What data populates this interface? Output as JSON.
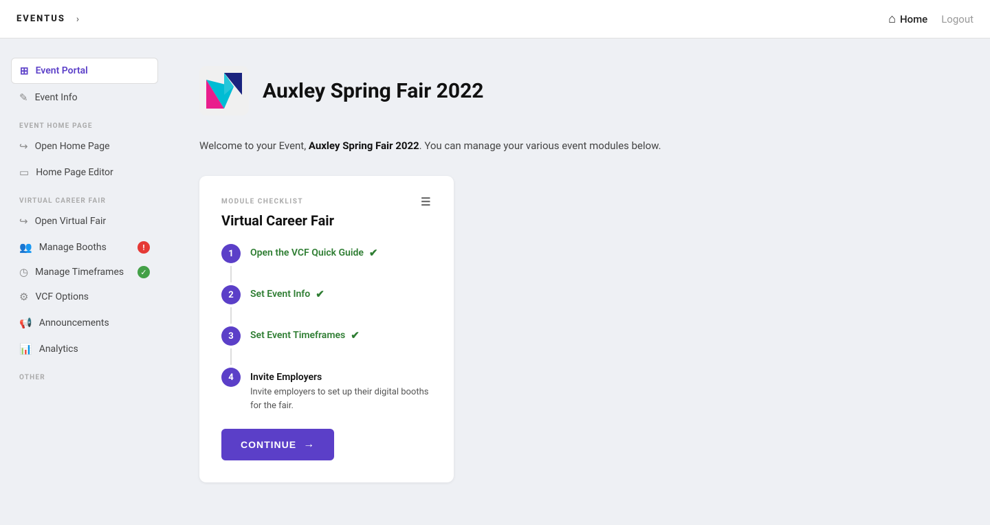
{
  "navbar": {
    "logo": "EVENTUS",
    "chevron": "›",
    "home_label": "Home",
    "logout_label": "Logout"
  },
  "sidebar": {
    "active_item": "Event Portal",
    "items_top": [
      {
        "id": "event-portal",
        "label": "Event Portal",
        "icon": "grid"
      },
      {
        "id": "event-info",
        "label": "Event Info",
        "icon": "edit"
      }
    ],
    "section_event_home_page": "EVENT HOME PAGE",
    "items_home": [
      {
        "id": "open-home-page",
        "label": "Open Home Page",
        "icon": "arrow-right"
      },
      {
        "id": "home-page-editor",
        "label": "Home Page Editor",
        "icon": "monitor"
      }
    ],
    "section_vcf": "VIRTUAL CAREER FAIR",
    "items_vcf": [
      {
        "id": "open-virtual-fair",
        "label": "Open Virtual Fair",
        "icon": "arrow-right"
      },
      {
        "id": "manage-booths",
        "label": "Manage Booths",
        "icon": "users",
        "badge": "red",
        "badge_value": "!"
      },
      {
        "id": "manage-timeframes",
        "label": "Manage Timeframes",
        "icon": "clock",
        "badge": "green",
        "badge_value": "✓"
      },
      {
        "id": "vcf-options",
        "label": "VCF Options",
        "icon": "settings"
      },
      {
        "id": "announcements",
        "label": "Announcements",
        "icon": "megaphone"
      },
      {
        "id": "analytics",
        "label": "Analytics",
        "icon": "bar-chart"
      }
    ],
    "section_other": "OTHER"
  },
  "event": {
    "name": "Auxley Spring Fair 2022"
  },
  "welcome": {
    "prefix": "Welcome to your Event, ",
    "event_name_bold": "Auxley Spring Fair 2022",
    "suffix": ". You can manage your various event modules below."
  },
  "module_card": {
    "checklist_label": "MODULE CHECKLIST",
    "title": "Virtual Career Fair",
    "steps": [
      {
        "num": "1",
        "label": "Open the VCF Quick Guide",
        "done": true
      },
      {
        "num": "2",
        "label": "Set Event Info",
        "done": true
      },
      {
        "num": "3",
        "label": "Set Event Timeframes",
        "done": true
      },
      {
        "num": "4",
        "label": "Invite Employers",
        "done": false
      }
    ],
    "invite_desc": "Invite employers to set up their digital booths for the fair.",
    "continue_label": "CONTINUE"
  }
}
